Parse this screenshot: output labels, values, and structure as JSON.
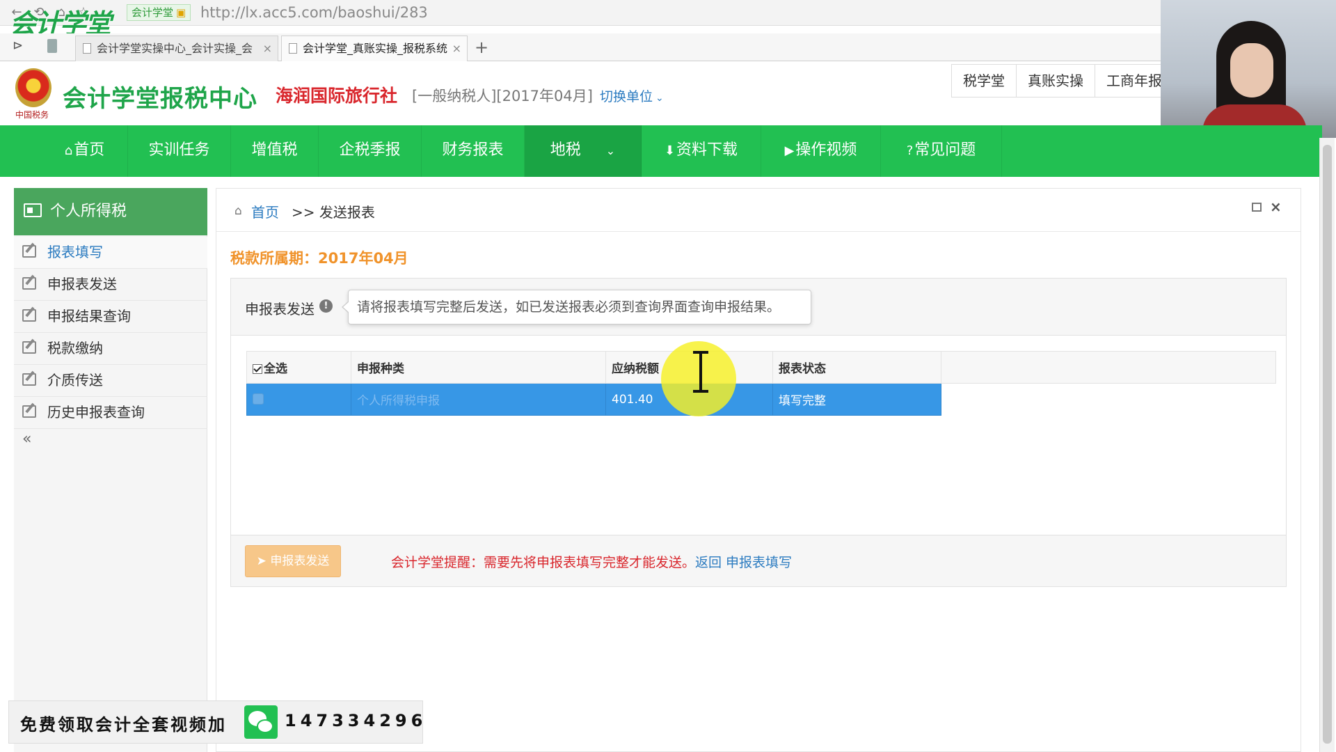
{
  "browser": {
    "url": "http://lx.acc5.com/baoshui/283",
    "url_host": "lx.acc5.com",
    "site_badge": "会计学堂",
    "brand_overlay": "会计学堂",
    "tabs": [
      {
        "label": "会计学堂实操中心_会计实操_会"
      },
      {
        "label": "会计学堂_真账实操_报税系统"
      }
    ],
    "nav_buttons": [
      "⟲",
      "⌂",
      "☆"
    ]
  },
  "header": {
    "site_title": "会计学堂报税中心",
    "emblem_caption": "中国税务",
    "company_name": "海润国际旅行社",
    "company_info": "[一般纳税人][2017年04月]",
    "switch_unit": "切换单位",
    "quick_buttons": [
      "税学堂",
      "真账实操",
      "工商年报"
    ]
  },
  "main_nav": {
    "items": [
      "首页",
      "实训任务",
      "增值税",
      "企税季报",
      "财务报表",
      "地税",
      "资料下载",
      "操作视频",
      "常见问题"
    ],
    "active": "地税"
  },
  "sidebar": {
    "title": "个人所得税",
    "items": [
      "报表填写",
      "申报表发送",
      "申报结果查询",
      "税款缴纳",
      "介质传送",
      "历史申报表查询"
    ],
    "active": "报表填写",
    "collapse_glyph": "«"
  },
  "breadcrumb": {
    "home": "首页",
    "current": ">> 发送报表"
  },
  "period": "税款所属期：2017年04月",
  "declare": {
    "title": "申报表发送",
    "tip": "请将报表填写完整后发送，如已发送报表必须到查询界面查询申报结果。",
    "table": {
      "headers": [
        "全选",
        "申报种类",
        "应纳税额",
        "报表状态"
      ],
      "rows": [
        {
          "type": "个人所得税申报",
          "amount": "401.40",
          "status": "填写完整"
        }
      ]
    },
    "send_button": "申报表发送",
    "reminder": "会计学堂提醒：需要先将申报表填写完整才能发送。",
    "reminder_link": "返回 申报表填写"
  },
  "promo": {
    "text": "免费领取会计全套视频加",
    "number": "147334296"
  },
  "colors": {
    "nav_green": "#22c052",
    "sidebar_header": "#4aa65d",
    "selected_row": "#3797e6",
    "period_orange": "#f0932b",
    "company_red": "#d9262c",
    "link_blue": "#2b7bc0"
  }
}
